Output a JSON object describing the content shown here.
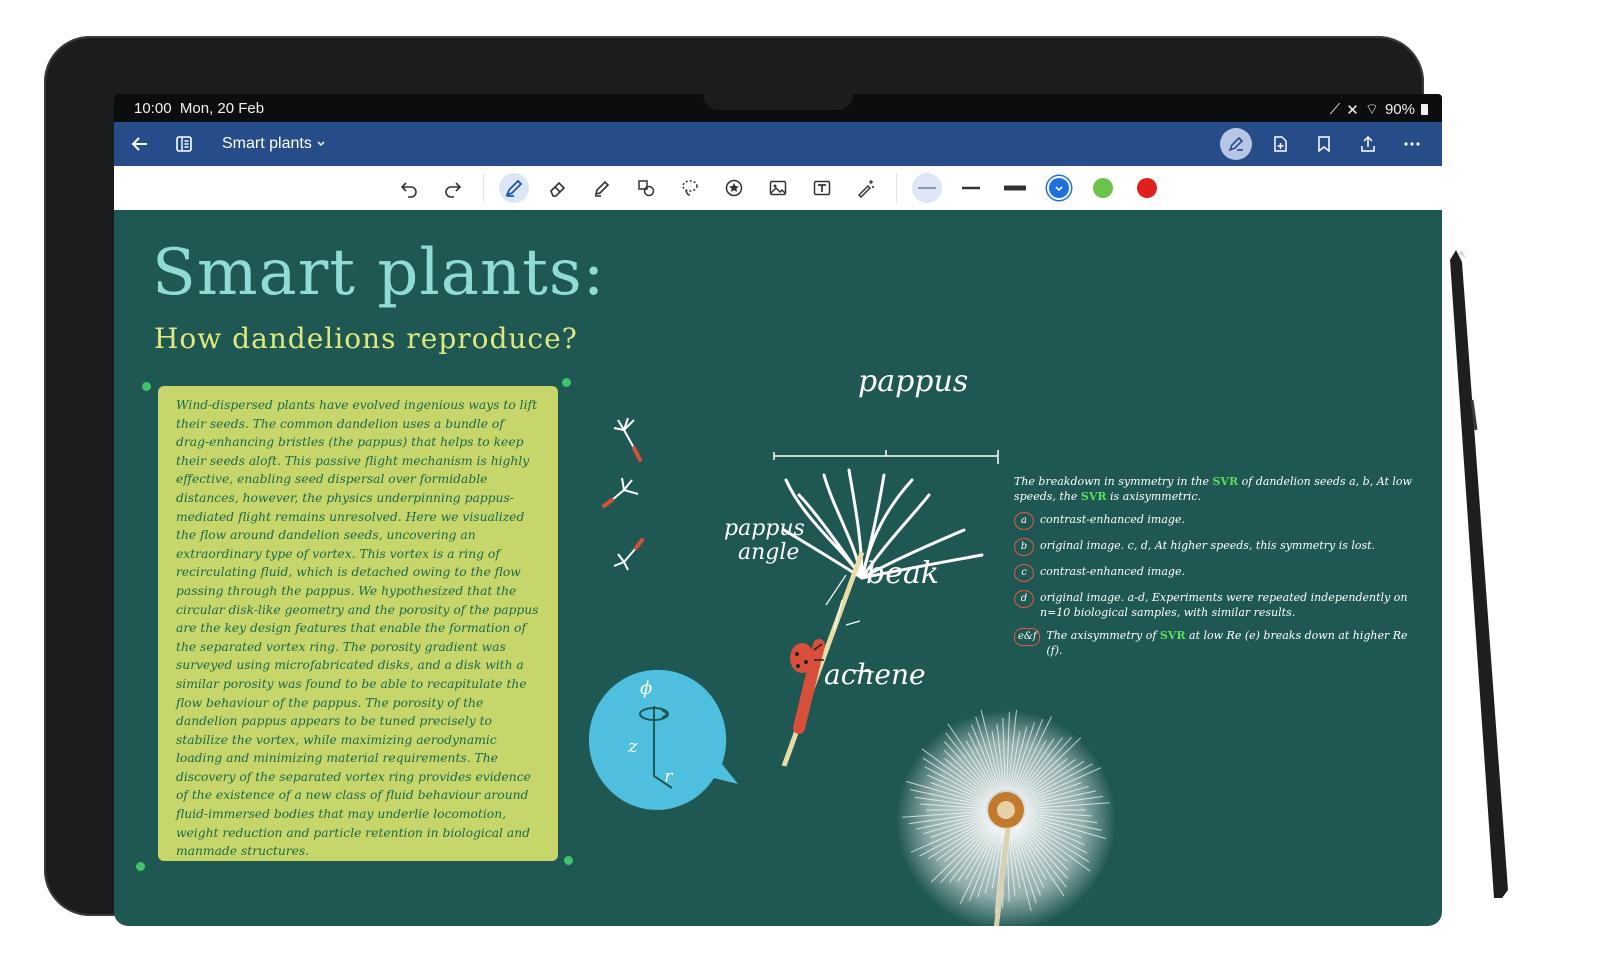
{
  "status": {
    "time": "10:00",
    "date": "Mon, 20 Feb",
    "battery": "90%"
  },
  "appbar": {
    "title": "Smart plants"
  },
  "canvas": {
    "title": "Smart plants:",
    "subtitle": "How dandelions reproduce?",
    "note_text": "Wind-dispersed plants have evolved ingenious ways to lift their seeds. The common dandelion uses a bundle of drag-enhancing bristles (the pappus) that helps to keep their seeds aloft. This passive flight mechanism is highly effective, enabling seed dispersal over formidable distances, however, the physics underpinning pappus-mediated flight remains unresolved. Here we visualized the flow around dandelion seeds, uncovering an extraordinary type of vortex. This vortex is a ring of recirculating fluid, which is detached owing to the flow passing through the pappus. We hypothesized that the circular disk-like geometry and the porosity of the pappus are the key design features that enable the formation of the separated vortex ring. The porosity gradient was surveyed using microfabricated disks, and a disk with a similar porosity was found to be able to recapitulate the flow behaviour of the pappus. The porosity of the dandelion pappus appears to be tuned precisely to stabilize the vortex, while maximizing aerodynamic loading and minimizing material requirements. The discovery of the separated vortex ring provides evidence of the existence of a new class of fluid behaviour around fluid-immersed bodies that may underlie locomotion, weight reduction and particle retention in biological and manmade structures.",
    "labels": {
      "pappus": "pappus",
      "pappus_angle_1": "pappus",
      "pappus_angle_2": "angle",
      "beak": "beak",
      "achene": "achene",
      "phi": "ϕ",
      "z": "z",
      "r": "r"
    },
    "list": {
      "intro_a": "The breakdown in symmetry in the",
      "intro_svr": "SVR",
      "intro_b": "of dandelion seeds a, b, At low speeds, the",
      "intro_svr2": "SVR",
      "intro_c": "is axisymmetric.",
      "items": [
        {
          "tag": "a",
          "text": "contrast-enhanced image."
        },
        {
          "tag": "b",
          "text": "original image. c, d, At higher speeds, this symmetry is lost."
        },
        {
          "tag": "c",
          "text": "contrast-enhanced image."
        },
        {
          "tag": "d",
          "text": "original image. a-d, Experiments were repeated independently on n=10 biological samples, with similar results."
        }
      ],
      "last_tag": "e&f",
      "last_a": "The axisymmetry of",
      "last_svr": "SVR",
      "last_b": "at low Re (e) breaks down at higher Re (f)."
    }
  },
  "colors": {
    "accent": "#264d8a",
    "canvas_bg": "#1f5752",
    "note_bg": "#c7d66b",
    "pen_blue": "#1d6fe0",
    "pen_green": "#6cc34a",
    "pen_red": "#e0201c"
  },
  "icons": [
    "back-icon",
    "notebook-icon",
    "chevron-down-icon",
    "pen-mode-icon",
    "add-page-icon",
    "bookmark-icon",
    "share-icon",
    "more-icon",
    "undo-icon",
    "redo-icon",
    "pen-icon",
    "eraser-icon",
    "highlighter-icon",
    "shapes-icon",
    "lasso-icon",
    "sticker-icon",
    "image-icon",
    "text-box-icon",
    "sparkle-icon"
  ]
}
